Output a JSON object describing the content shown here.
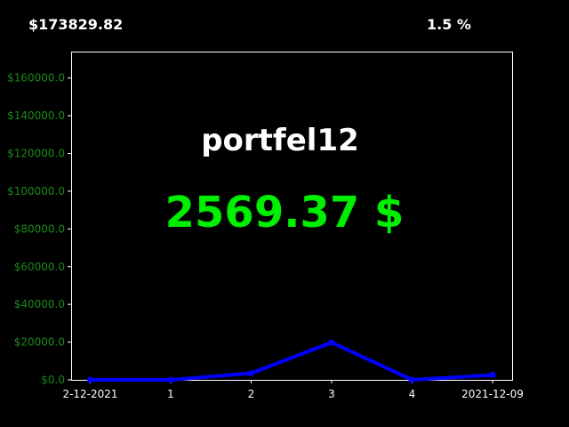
{
  "header": {
    "total_value": "$173829.82",
    "change_percent": "1.5 %"
  },
  "overlay": {
    "portfolio_name": "portfel12",
    "portfolio_value": "2569.37 $"
  },
  "colors": {
    "background": "#000000",
    "frame": "#ffffff",
    "line": "#0000ff",
    "y_tick_text": "#1a8a1a",
    "value_text": "#00ee00",
    "text": "#ffffff"
  },
  "chart_data": {
    "type": "line",
    "title": "",
    "xlabel": "",
    "ylabel": "",
    "categories": [
      "2-12-2021",
      "1",
      "2",
      "3",
      "4",
      "2021-12-09"
    ],
    "x": [
      0,
      1,
      2,
      3,
      4,
      5
    ],
    "values": [
      0,
      0,
      3500,
      19800,
      0,
      2569.37
    ],
    "ylim": [
      0,
      174000
    ],
    "yticks": [
      0,
      20000,
      40000,
      60000,
      80000,
      100000,
      120000,
      140000,
      160000
    ],
    "ytick_labels": [
      "$0.0",
      "$20000.0",
      "$40000.0",
      "$60000.0",
      "$80000.0",
      "$100000.0",
      "$120000.0",
      "$140000.0",
      "$160000.0"
    ],
    "grid": false,
    "legend": "none"
  }
}
